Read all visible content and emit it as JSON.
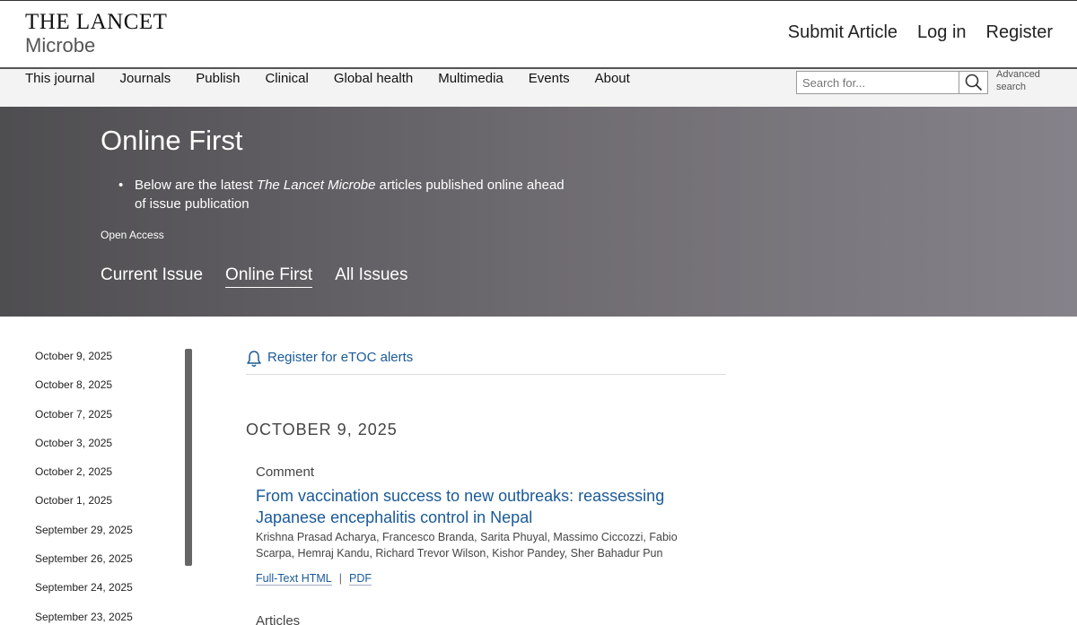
{
  "header": {
    "logo_title": "THE LANCET",
    "logo_subtitle": "Microbe",
    "submit_article": "Submit Article",
    "log_in": "Log in",
    "register": "Register"
  },
  "nav": {
    "items": [
      {
        "label": "This journal"
      },
      {
        "label": "Journals"
      },
      {
        "label": "Publish"
      },
      {
        "label": "Clinical"
      },
      {
        "label": "Global health"
      },
      {
        "label": "Multimedia"
      },
      {
        "label": "Events"
      },
      {
        "label": "About"
      }
    ],
    "search_placeholder": "Search for...",
    "search_icon": "magnifier-icon",
    "advanced_search": "Advanced search"
  },
  "hero": {
    "title": "Online First",
    "bullet_prefix": "Below are the latest ",
    "bullet_italic": "The Lancet Microbe",
    "bullet_suffix": " articles published online ahead of issue publication",
    "open_access": "Open Access",
    "tabs": [
      {
        "label": "Current Issue",
        "active": false
      },
      {
        "label": "Online First",
        "active": true
      },
      {
        "label": "All Issues",
        "active": false
      }
    ]
  },
  "sidebar": {
    "dates": [
      "October 9, 2025",
      "October 8, 2025",
      "October 7, 2025",
      "October 3, 2025",
      "October 2, 2025",
      "October 1, 2025",
      "September 29, 2025",
      "September 26, 2025",
      "September 24, 2025",
      "September 23, 2025"
    ]
  },
  "main": {
    "etoc_label": "Register for eTOC alerts",
    "etoc_icon": "bell-icon",
    "section_date": "OCTOBER 9, 2025",
    "article": {
      "type": "Comment",
      "title": "From vaccination success to new outbreaks: reassessing Japanese encephalitis control in Nepal",
      "authors": "Krishna Prasad Acharya, Francesco Branda, Sarita Phuyal, Massimo Ciccozzi, Fabio Scarpa, Hemraj Kandu, Richard Trevor Wilson, Kishor Pandey, Sher Bahadur Pun",
      "link_fulltext": "Full-Text HTML",
      "link_separator": "|",
      "link_pdf": "PDF"
    },
    "next_type": "Articles"
  },
  "colors": {
    "link": "#1a5a97",
    "hero_dark": "#4e4d50",
    "hero_light": "#85828a"
  }
}
